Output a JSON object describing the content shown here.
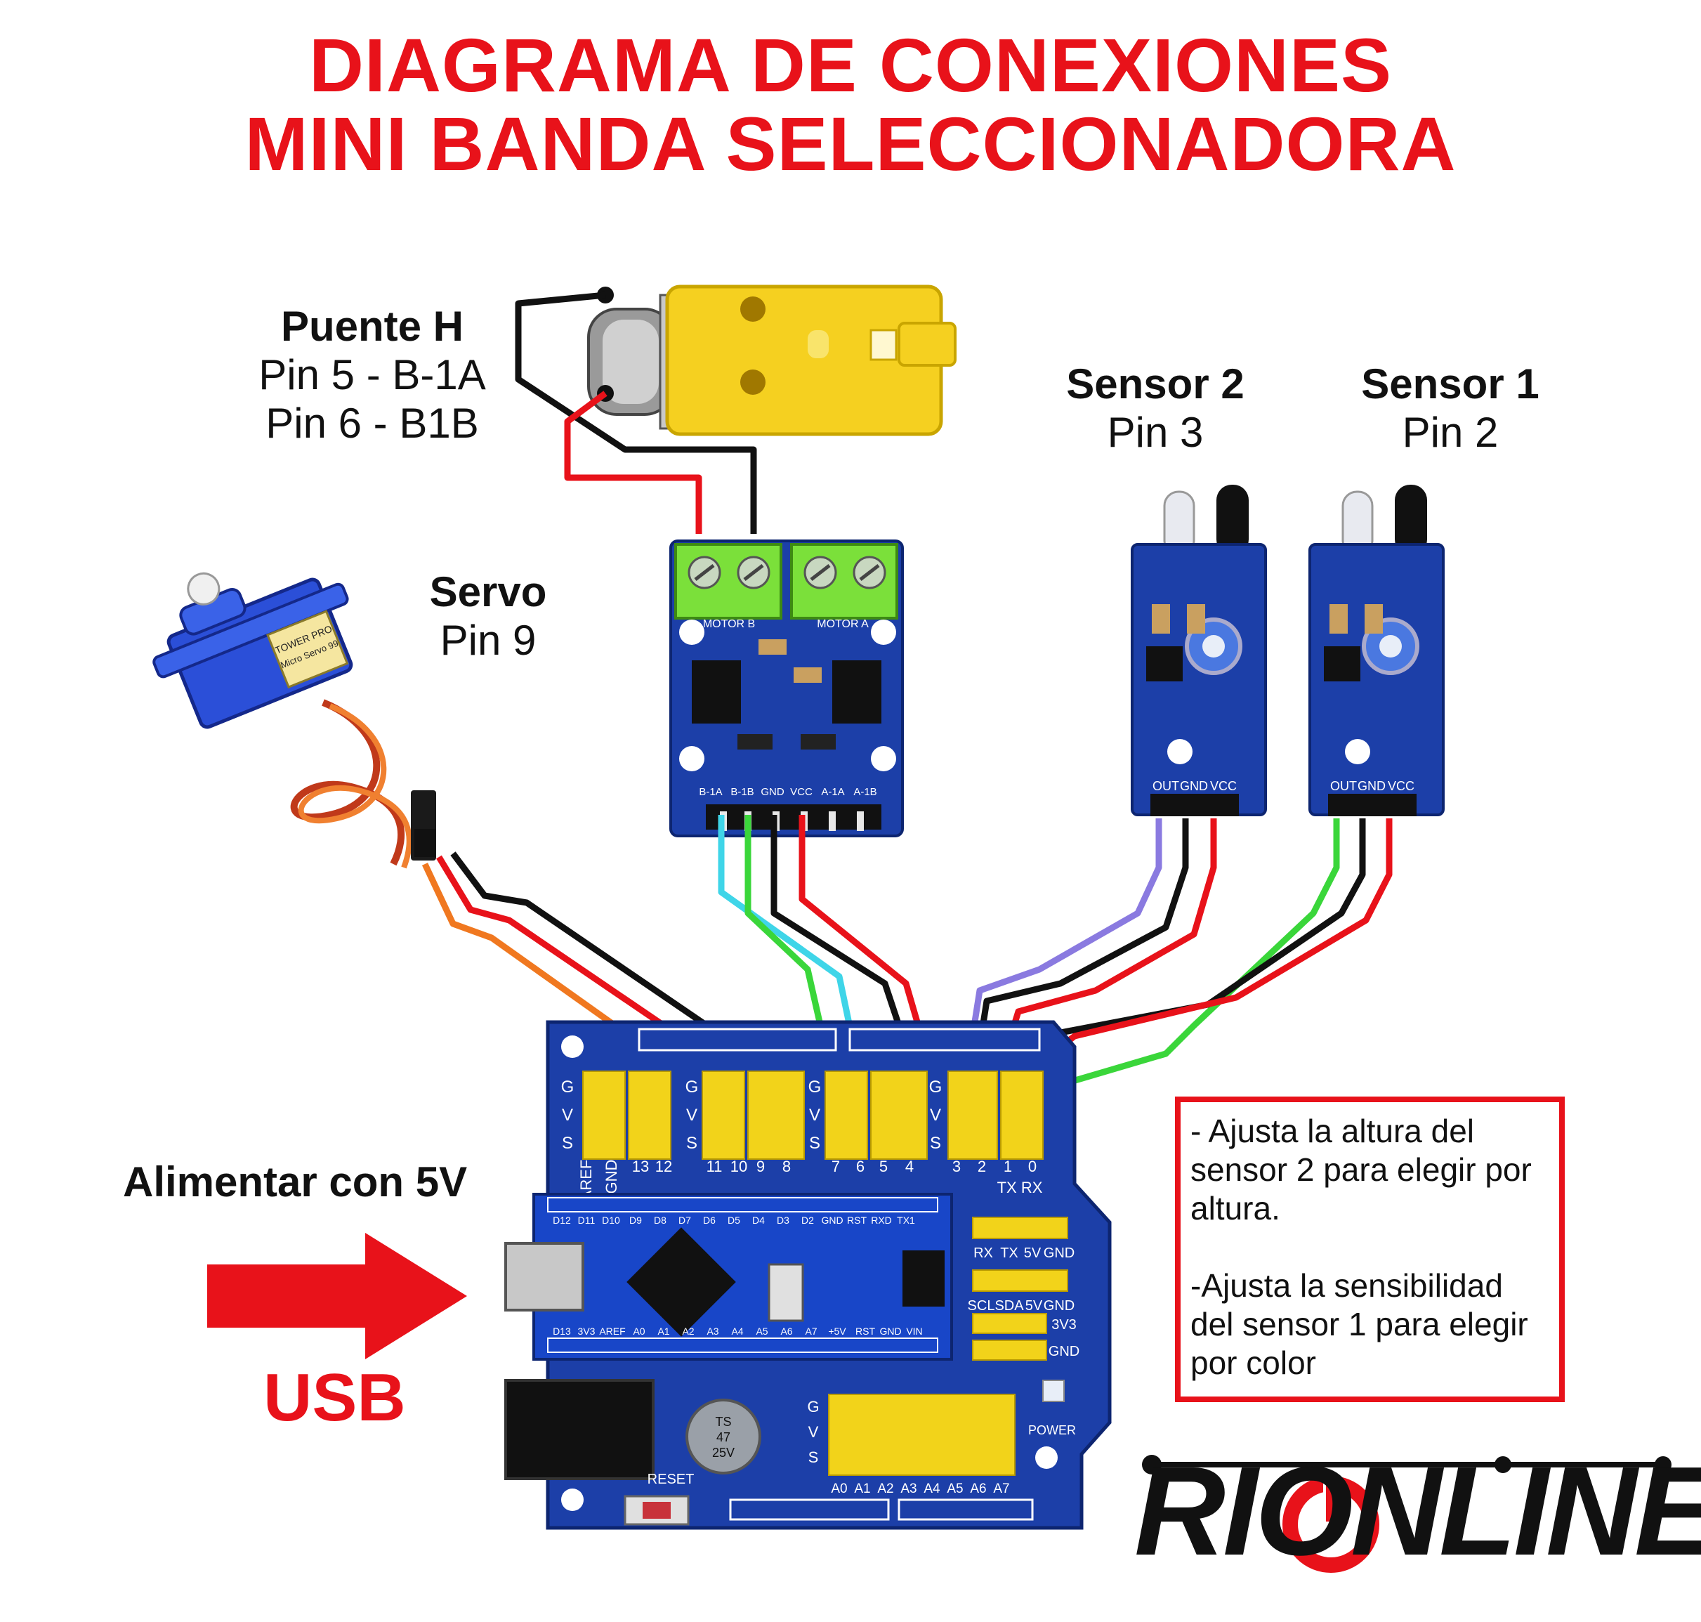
{
  "title": {
    "line1": "DIAGRAMA DE CONEXIONES",
    "line2": "MINI BANDA SELECCIONADORA"
  },
  "labels": {
    "hbridge": {
      "heading": "Puente H",
      "line1": "Pin 5 - B-1A",
      "line2": "Pin 6 - B1B"
    },
    "servo": {
      "heading": "Servo",
      "line1": "Pin 9"
    },
    "sensor2": {
      "heading": "Sensor 2",
      "line1": "Pin 3"
    },
    "sensor1": {
      "heading": "Sensor 1",
      "line1": "Pin 2"
    },
    "power": "Alimentar con 5V",
    "usb": "USB"
  },
  "notes": [
    "- Ajusta la altura del sensor 2 para elegir por altura.",
    "-Ajusta la sensibilidad del sensor 1 para elegir por color"
  ],
  "board_labels": {
    "hbridge_top": [
      "MOTOR B",
      "MOTOR A"
    ],
    "hbridge_pins": [
      "B-1A",
      "B-1B",
      "GND",
      "VCC",
      "A-1A",
      "A-1B"
    ],
    "sensor_pins": [
      "OUT",
      "GND",
      "VCC"
    ],
    "shield_rows": [
      "G",
      "V",
      "S"
    ],
    "shield_digital": [
      "AREF",
      "GND",
      "13",
      "12",
      "11",
      "10",
      "9",
      "8",
      "7",
      "6",
      "5",
      "4",
      "3",
      "2",
      "1",
      "0"
    ],
    "shield_txrx": "TX RX",
    "shield_side": [
      "RX",
      "TX",
      "5V",
      "GND",
      "SCL",
      "SDA",
      "5V",
      "GND",
      "3V3",
      "GND"
    ],
    "shield_analog": [
      "A0",
      "A1",
      "A2",
      "A3",
      "A4",
      "A5",
      "A6",
      "A7"
    ],
    "shield_reset": "RESET",
    "shield_power": "POWER",
    "nano_top": [
      "D12",
      "D11",
      "D10",
      "D9",
      "D8",
      "D7",
      "D6",
      "D5",
      "D4",
      "D3",
      "D2",
      "GND",
      "RST",
      "RXD",
      "TX1"
    ],
    "nano_bottom": [
      "D13",
      "3V3",
      "AREF",
      "A0",
      "A1",
      "A2",
      "A3",
      "A4",
      "A5",
      "A6",
      "A7",
      "+5V",
      "RST",
      "GND",
      "VIN"
    ],
    "servo_brand": "TOWER PRO",
    "servo_model": "Micro Servo 99",
    "capacitor": [
      "TS",
      "47",
      "25V"
    ]
  },
  "logo": "RIONLINE",
  "colors": {
    "title": "#e8121a",
    "board_blue": "#1c3fa8",
    "header_yellow": "#f2d31a",
    "terminal_green": "#7be03a",
    "motor_yellow": "#f5d020",
    "wire_red": "#e8121a",
    "wire_black": "#111111",
    "wire_cyan": "#3fd5e8",
    "wire_green": "#3ad63a",
    "wire_purple": "#8a7ae0",
    "wire_orange": "#f07820"
  }
}
